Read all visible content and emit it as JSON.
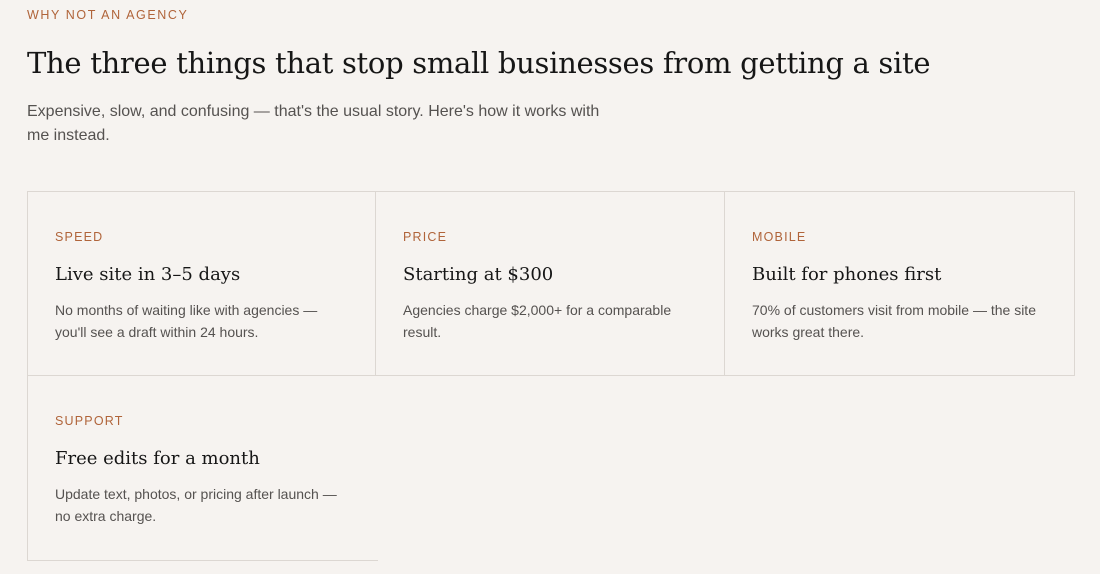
{
  "section": {
    "eyebrow": "WHY NOT AN AGENCY",
    "headline": "The three things that stop small businesses from getting a site",
    "subhead": "Expensive, slow, and confusing — that's the usual story. Here's how it works with me instead."
  },
  "cards": [
    {
      "label": "SPEED",
      "title": "Live site in 3–5 days",
      "text": "No months of waiting like with agencies — you'll see a draft within 24 hours."
    },
    {
      "label": "PRICE",
      "title": "Starting at $300",
      "text": "Agencies charge $2,000+ for a comparable result."
    },
    {
      "label": "MOBILE",
      "title": "Built for phones first",
      "text": "70% of customers visit from mobile — the site works great there."
    },
    {
      "label": "SUPPORT",
      "title": "Free edits for a month",
      "text": "Update text, photos, or pricing after launch — no extra charge."
    }
  ],
  "colors": {
    "background": "#f6f3f0",
    "accent": "#b0643a",
    "heading": "#161616",
    "body_text": "#555250",
    "border": "#dcd7d2"
  }
}
